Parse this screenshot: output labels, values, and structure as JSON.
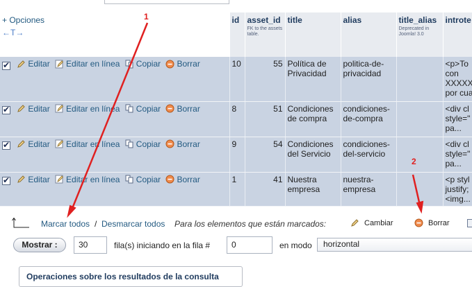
{
  "header": {
    "options_label": "+ Opciones",
    "sort_arrows": "←T→",
    "columns": [
      {
        "label": "id",
        "note": ""
      },
      {
        "label": "asset_id",
        "note": "FK to the assets table."
      },
      {
        "label": "title",
        "note": ""
      },
      {
        "label": "alias",
        "note": ""
      },
      {
        "label": "title_alias",
        "note": "Deprecated in Joomla! 3.0"
      },
      {
        "label": "introte",
        "note": ""
      }
    ]
  },
  "actions": {
    "edit": "Editar",
    "inline_edit": "Editar en línea",
    "copy": "Copiar",
    "delete": "Borrar"
  },
  "rows": [
    {
      "id": "10",
      "asset_id": "55",
      "title": "Política de Privacidad",
      "alias": "politica-de-privacidad",
      "title_alias": "",
      "introtext": "<p>To<br>con<br>XXXXX<br>por cua"
    },
    {
      "id": "8",
      "asset_id": "51",
      "title": "Condiciones de compra",
      "alias": "condiciones-de-compra",
      "title_alias": "",
      "introtext": "<div cl<br>style=\"<br>pa..."
    },
    {
      "id": "9",
      "asset_id": "54",
      "title": "Condiciones del Servicio",
      "alias": "condiciones-del-servicio",
      "title_alias": "",
      "introtext": "<div cl<br>style=\"<br>pa..."
    },
    {
      "id": "1",
      "asset_id": "41",
      "title": "Nuestra empresa",
      "alias": "nuestra-empresa",
      "title_alias": "",
      "introtext": "<p styl<br>justify;<br><img..."
    }
  ],
  "bulk": {
    "check_all": "Marcar todos",
    "separator": "/",
    "uncheck_all": "Desmarcar todos",
    "with_selected": "Para los elementos que están marcados:",
    "change": "Cambiar",
    "delete": "Borrar"
  },
  "navigation": {
    "show_button": "Mostrar :",
    "rows_value": "30",
    "rows_label": "fila(s) iniciando en la fila #",
    "start_value": "0",
    "mode_label": "en modo",
    "mode_value": "horizontal"
  },
  "operations_title": "Operaciones sobre los resultados de la consulta",
  "annotations": {
    "marker_1": "1",
    "marker_2": "2",
    "color": "#e02020"
  },
  "colors": {
    "row_bg": "#c9d3e2",
    "header_bg": "#e8ebf0",
    "link": "#235a81"
  }
}
